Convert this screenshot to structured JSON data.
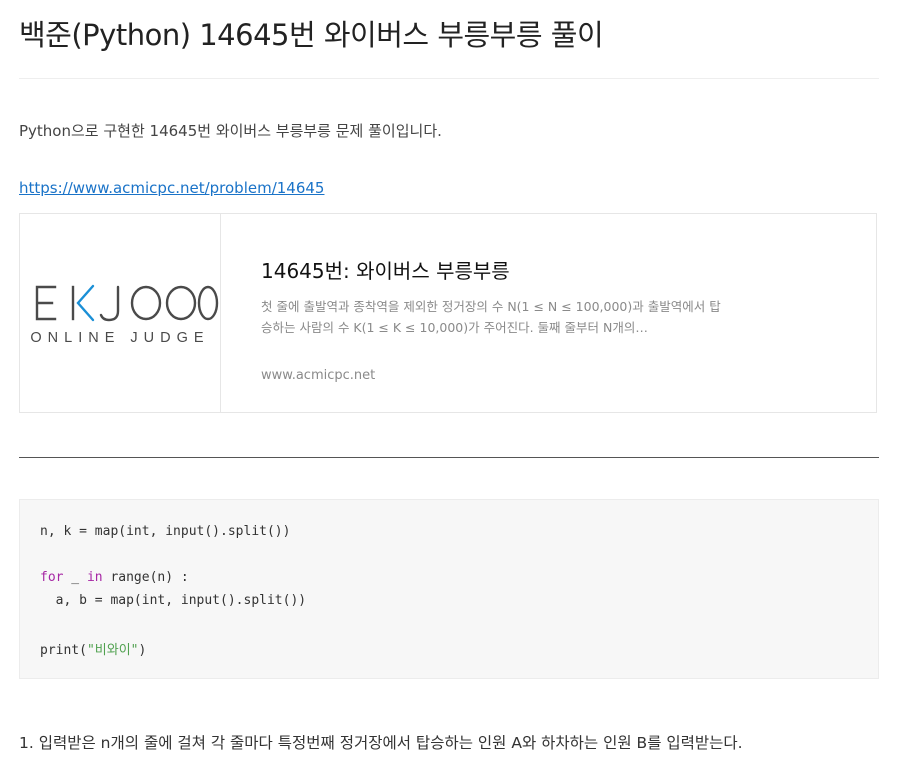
{
  "post": {
    "title": "백준(Python) 14645번 와이버스 부릉부릉 풀이",
    "intro": "Python으로 구현한 14645번 와이버스 부릉부릉 문제 풀이입니다.",
    "link": "https://www.acmicpc.net/problem/14645"
  },
  "og_card": {
    "logo_main": "EKJOO",
    "logo_sub": "ONLINE JUDGE",
    "title": "14645번: 와이버스 부릉부릉",
    "description": "첫 줄에 출발역과 종착역을 제외한 정거장의 수 N(1 ≤ N ≤ 100,000)과 출발역에서 탑승하는 사람의 수 K(1 ≤ K ≤ 10,000)가 주어진다. 둘째 줄부터 N개의…",
    "host": "www.acmicpc.net"
  },
  "code": {
    "line1": "n, k = map(int, input().split())",
    "line2_kw1": "for",
    "line2_mid": " _ ",
    "line2_kw2": "in",
    "line2_rest": " range(n) :",
    "line3": "  a, b = map(int, input().split())",
    "line4_pre": "print(",
    "line4_str": "\"비와이\"",
    "line4_post": ")"
  },
  "steps": {
    "step1": "1. 입력받은 n개의 줄에 걸쳐 각 줄마다 특정번째 정거장에서 탑승하는 인원 A와 하차하는 인원 B를 입력받는다."
  },
  "colors": {
    "link": "#1a73c8",
    "logo_dark": "#4a4a4a",
    "logo_accent": "#1a8fd6",
    "keyword": "#a626a4",
    "string": "#50a14f"
  }
}
